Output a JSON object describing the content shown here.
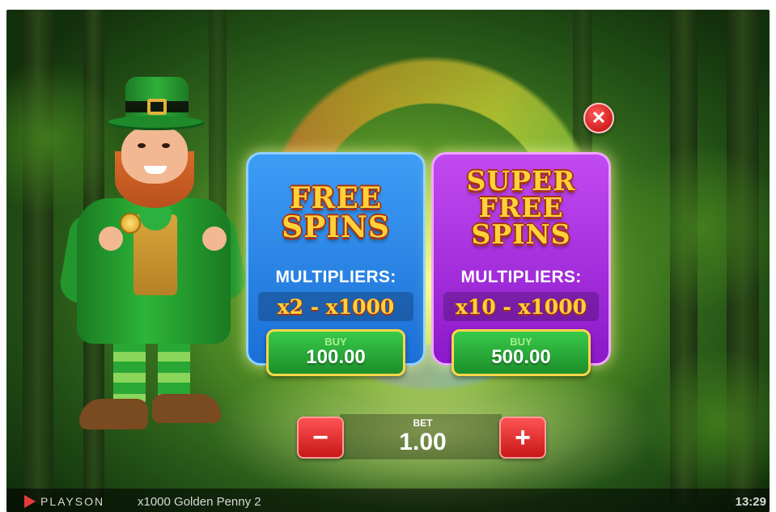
{
  "cards": [
    {
      "title_lines": [
        "FREE",
        "SPINS"
      ],
      "multipliers_label": "MULTIPLIERS:",
      "multipliers_value": "x2 - x1000",
      "buy_label": "BUY",
      "buy_price": "100.00",
      "color": "#2a86ea"
    },
    {
      "title_lines": [
        "SUPER",
        "FREE",
        "SPINS"
      ],
      "multipliers_label": "MULTIPLIERS:",
      "multipliers_value": "x10 - x1000",
      "buy_label": "BUY",
      "buy_price": "500.00",
      "color": "#a82fe0"
    }
  ],
  "bet": {
    "label": "BET",
    "value": "1.00",
    "minus_symbol": "−",
    "plus_symbol": "+"
  },
  "close_symbol": "✕",
  "footer": {
    "brand": "PLAYSON",
    "game_title": "x1000 Golden Penny 2",
    "time": "13:29"
  },
  "icons": {
    "close": "close-icon",
    "minus": "minus-icon",
    "plus": "plus-icon",
    "brand": "playson-logo-icon"
  },
  "colors": {
    "accent_gold": "#ffd23a",
    "button_green": "#2db13c",
    "button_red": "#e22b2b"
  }
}
